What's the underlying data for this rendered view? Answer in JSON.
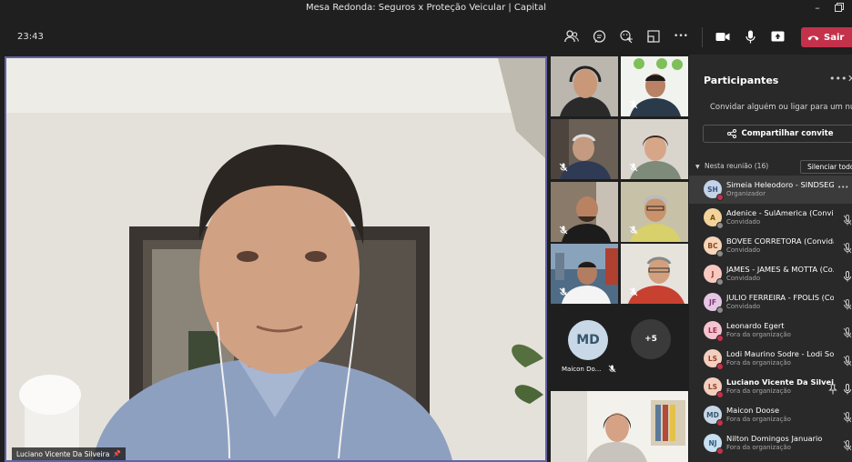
{
  "window": {
    "title": "Mesa Redonda: Seguros x Proteção Veicular | Capital"
  },
  "toolbar": {
    "time": "23:43",
    "leave_label": "Sair",
    "more_glyph": "•••"
  },
  "stage": {
    "main_speaker": "Luciano Vicente Da Silveira"
  },
  "gallery": {
    "md_initials": "MD",
    "md_name": "Maicon Do...",
    "overflow": "+5"
  },
  "panel": {
    "title": "Participantes",
    "invite_placeholder": "Convidar alguém ou ligar para um núme",
    "share_label": "Compartilhar convite",
    "section_label": "Nesta reunião (16)",
    "mute_all_label": "Silenciar todos",
    "participants": [
      {
        "initials": "SH",
        "name": "Simeia Heleodoro - SINDSEG...",
        "role": "Organizador",
        "avatar_bg": "#c5d3e8",
        "avatar_fg": "#36507a",
        "status": "#c4314b"
      },
      {
        "initials": "A",
        "name": "Adenice - SulAmerica (Convid...",
        "role": "Convidado",
        "avatar_bg": "#f2d49b",
        "avatar_fg": "#7a5512",
        "status": "#8a8a8a"
      },
      {
        "initials": "BC",
        "name": "BOVEE CORRETORA (Convida...",
        "role": "Convidado",
        "avatar_bg": "#f6d5b8",
        "avatar_fg": "#8a4a1f",
        "status": "#8a8a8a"
      },
      {
        "initials": "J",
        "name": "JAMES - JAMES & MOTTA (Co...",
        "role": "Convidado",
        "avatar_bg": "#f7c9c1",
        "avatar_fg": "#96392a",
        "status": "#8a8a8a"
      },
      {
        "initials": "JF",
        "name": "JULIO FERREIRA - FPOLIS (Co...",
        "role": "Convidado",
        "avatar_bg": "#e6c6e3",
        "avatar_fg": "#7b3a75",
        "status": "#8a8a8a"
      },
      {
        "initials": "LE",
        "name": "Leonardo Egert",
        "role": "Fora da organização",
        "avatar_bg": "#f5c4d0",
        "avatar_fg": "#9a2f4d",
        "status": "#c4314b"
      },
      {
        "initials": "LS",
        "name": "Lodi Maurino Sodre - Lodi So...",
        "role": "Fora da organização",
        "avatar_bg": "#f4cfc0",
        "avatar_fg": "#92452b",
        "status": "#c4314b"
      },
      {
        "initials": "LS",
        "name": "Luciano Vicente Da Silvei...",
        "role": "Fora da organização",
        "avatar_bg": "#f4cfc0",
        "avatar_fg": "#92452b",
        "status": "#c4314b"
      },
      {
        "initials": "MD",
        "name": "Maicon Doose",
        "role": "Fora da organização",
        "avatar_bg": "#c8d8e6",
        "avatar_fg": "#36566e",
        "status": "#c4314b"
      },
      {
        "initials": "NJ",
        "name": "Nilton Domingos Januario",
        "role": "Fora da organização",
        "avatar_bg": "#c7dff0",
        "avatar_fg": "#2e5c80",
        "status": "#c4314b"
      }
    ]
  },
  "colors": {
    "accent": "#6264a7",
    "leave": "#c4314b",
    "background": "#1f1f1f",
    "panel": "#292929"
  }
}
